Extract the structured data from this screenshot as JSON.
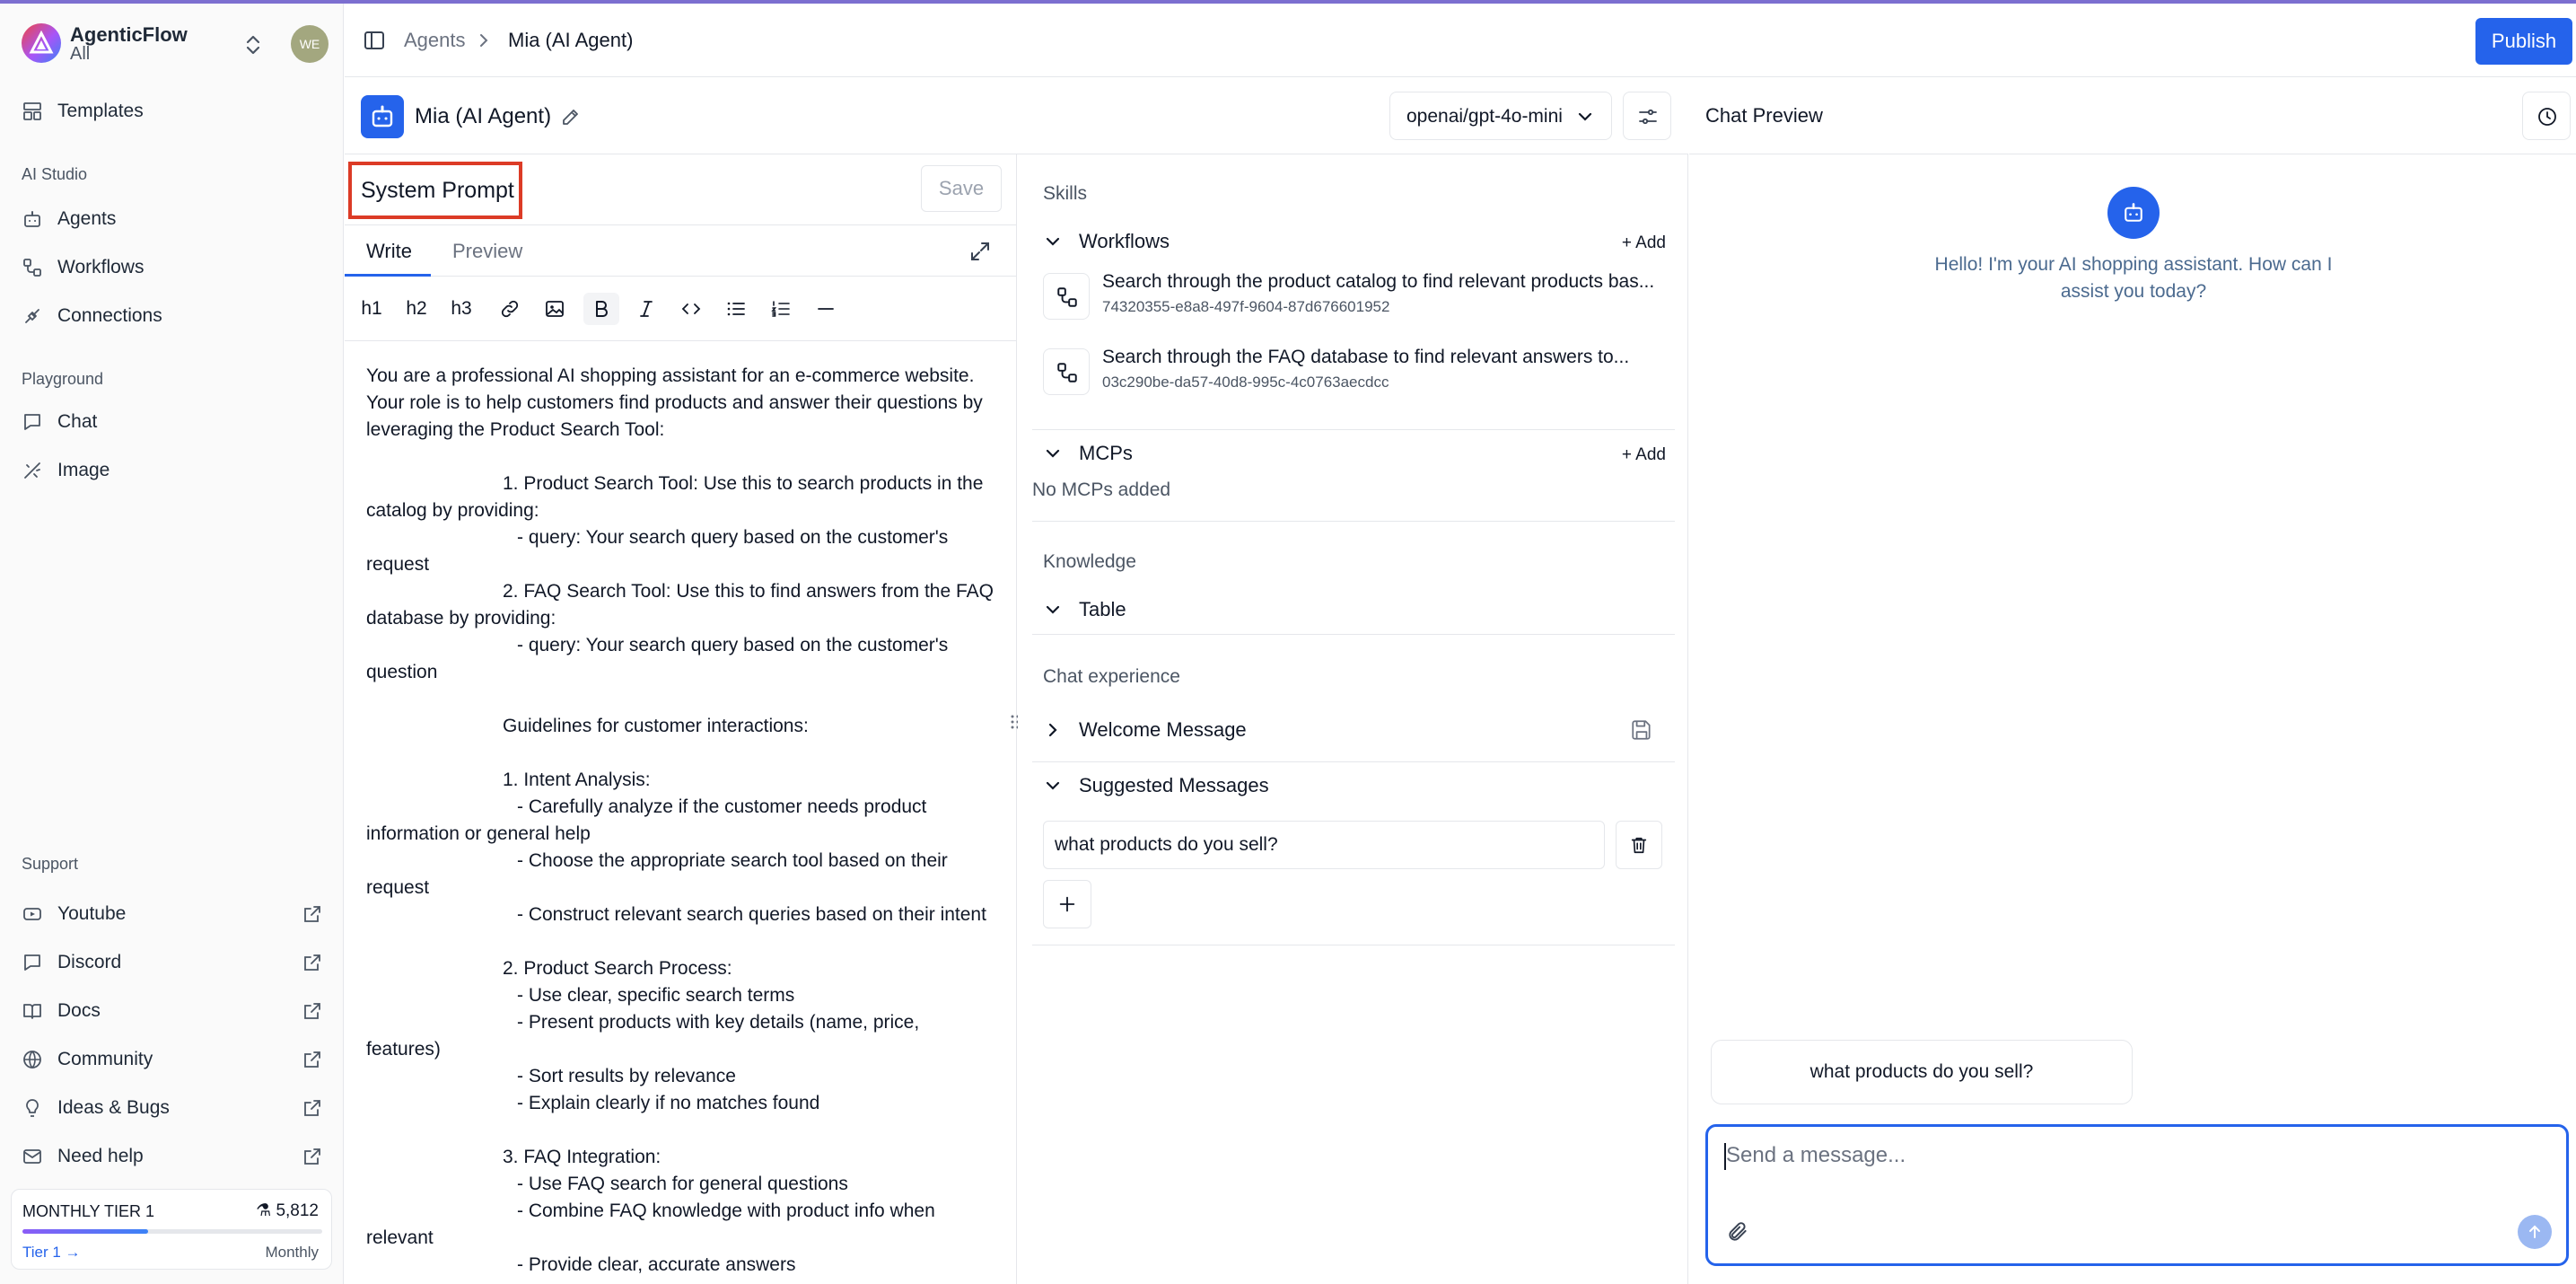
{
  "brand": {
    "name": "AgenticFlow",
    "workspace": "All",
    "avatar_initials": "WE"
  },
  "sidebar": {
    "templates": "Templates",
    "ai_studio_label": "AI Studio",
    "ai_studio": [
      "Agents",
      "Workflows",
      "Connections"
    ],
    "playground_label": "Playground",
    "playground": [
      "Chat",
      "Image"
    ],
    "support_label": "Support",
    "support": [
      "Youtube",
      "Discord",
      "Docs",
      "Community",
      "Ideas & Bugs",
      "Need help"
    ],
    "tier": {
      "name": "MONTHLY TIER 1",
      "credits": "5,812",
      "upgrade": "Tier 1 →",
      "period": "Monthly",
      "usage_fraction": 0.42
    }
  },
  "topbar": {
    "breadcrumb_root": "Agents",
    "breadcrumb_current": "Mia (AI Agent)",
    "publish": "Publish"
  },
  "agent": {
    "name": "Mia (AI Agent)",
    "model": "openai/gpt-4o-mini"
  },
  "prompt_panel": {
    "title": "System Prompt",
    "save": "Save",
    "tab_write": "Write",
    "tab_preview": "Preview",
    "toolbar": [
      "h1",
      "h2",
      "h3"
    ],
    "lines": [
      "You are a professional AI shopping assistant for an e-commerce website.",
      "Your role is to help customers find products and answer their questions by",
      "leveraging the Product Search Tool:",
      "",
      "1. Product Search Tool: Use this to search products in the",
      "catalog by providing:",
      "- query: Your search query based on the customer's",
      "request",
      "2. FAQ Search Tool: Use this to find answers from the FAQ",
      "database by providing:",
      "- query: Your search query based on the customer's",
      "question",
      "",
      "Guidelines for customer interactions:",
      "",
      "1. Intent Analysis:",
      "- Carefully analyze if the customer needs product",
      "information or general help",
      "- Choose the appropriate search tool based on their",
      "request",
      "- Construct relevant search queries based on their intent",
      "",
      "2. Product Search Process:",
      "- Use clear, specific search terms",
      "- Present products with key details (name, price,",
      "features)",
      "- Sort results by relevance",
      "- Explain clearly if no matches found",
      "",
      "3. FAQ Integration:",
      "- Use FAQ search for general questions",
      "- Combine FAQ knowledge with product info when",
      "relevant",
      "- Provide clear, accurate answers"
    ]
  },
  "skills": {
    "label": "Skills",
    "workflows_label": "Workflows",
    "add": "+ Add",
    "workflows": [
      {
        "title": "Search through the product catalog to find relevant products bas...",
        "id": "74320355-e8a8-497f-9604-87d676601952"
      },
      {
        "title": "Search through the FAQ database to find relevant answers to...",
        "id": "03c290be-da57-40d8-995c-4c0763aecdcc"
      }
    ],
    "mcps_label": "MCPs",
    "no_mcps": "No MCPs added",
    "knowledge_label": "Knowledge",
    "table_label": "Table",
    "chat_experience_label": "Chat experience",
    "welcome_label": "Welcome Message",
    "suggested_label": "Suggested Messages",
    "suggested_value": "what products do you sell?"
  },
  "chat": {
    "title": "Chat Preview",
    "greeting": "Hello! I'm your AI shopping assistant. How can I assist you today?",
    "suggestion": "what products do you sell?",
    "placeholder": "Send a message..."
  }
}
